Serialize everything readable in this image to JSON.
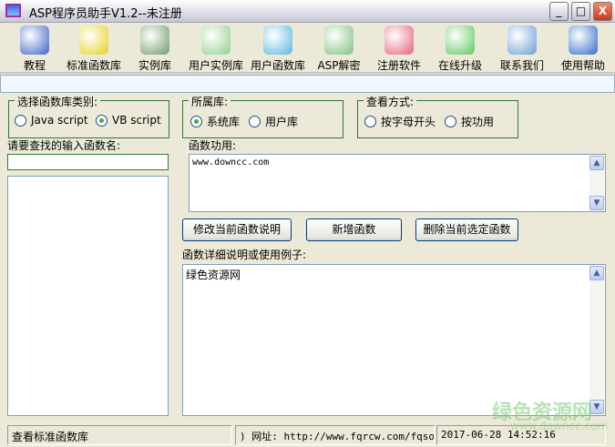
{
  "window": {
    "title": "ASP程序员助手V1.2--未注册",
    "minimize": "_",
    "maximize": "□",
    "close": "X"
  },
  "toolbar": [
    {
      "label": "教程",
      "icon": "books-icon",
      "color": "#3d62c8"
    },
    {
      "label": "标准函数库",
      "icon": "cubes-icon",
      "color": "#e8d020"
    },
    {
      "label": "实例库",
      "icon": "folder-icon",
      "color": "#6f9a6a"
    },
    {
      "label": "用户实例库",
      "icon": "disc-icon",
      "color": "#8fd08f"
    },
    {
      "label": "用户函数库",
      "icon": "user-chat-icon",
      "color": "#5cb8e0"
    },
    {
      "label": "ASP解密",
      "icon": "picture-icon",
      "color": "#7fc07f"
    },
    {
      "label": "注册软件",
      "icon": "hearts-icon",
      "color": "#e8607a"
    },
    {
      "label": "在线升级",
      "icon": "upgrade-arrow-icon",
      "color": "#5cc85c"
    },
    {
      "label": "联系我们",
      "icon": "book-pen-icon",
      "color": "#6aa0d8"
    },
    {
      "label": "使用帮助",
      "icon": "help-icon",
      "color": "#2f6ccc"
    }
  ],
  "groups": {
    "category": {
      "title": "选择函数库类别:",
      "options": [
        "Java script",
        "VB script"
      ],
      "selected": 1
    },
    "library": {
      "title": "所属库:",
      "options": [
        "系统库",
        "用户库"
      ],
      "selected": 0
    },
    "view": {
      "title": "查看方式:",
      "options": [
        "按字母开头",
        "按功用"
      ],
      "selected": -1
    }
  },
  "search": {
    "label": "请要查找的输入函数名:",
    "value": ""
  },
  "function_use": {
    "label": "函数功用:",
    "value": "www.downcc.com"
  },
  "buttons": {
    "edit": "修改当前函数说明",
    "add": "新增函数",
    "delete": "删除当前选定函数"
  },
  "details": {
    "label": "函数详细说明或使用例子:",
    "value": "绿色资源网"
  },
  "status": {
    "left": "查看标准函数库",
    "middle": ")  网址: http://www.fqrcw.com/fqsoft/",
    "right": "2017-06-28 14:52:16"
  },
  "watermark": {
    "title": "绿色资源网",
    "url": "www.downcc.com"
  }
}
